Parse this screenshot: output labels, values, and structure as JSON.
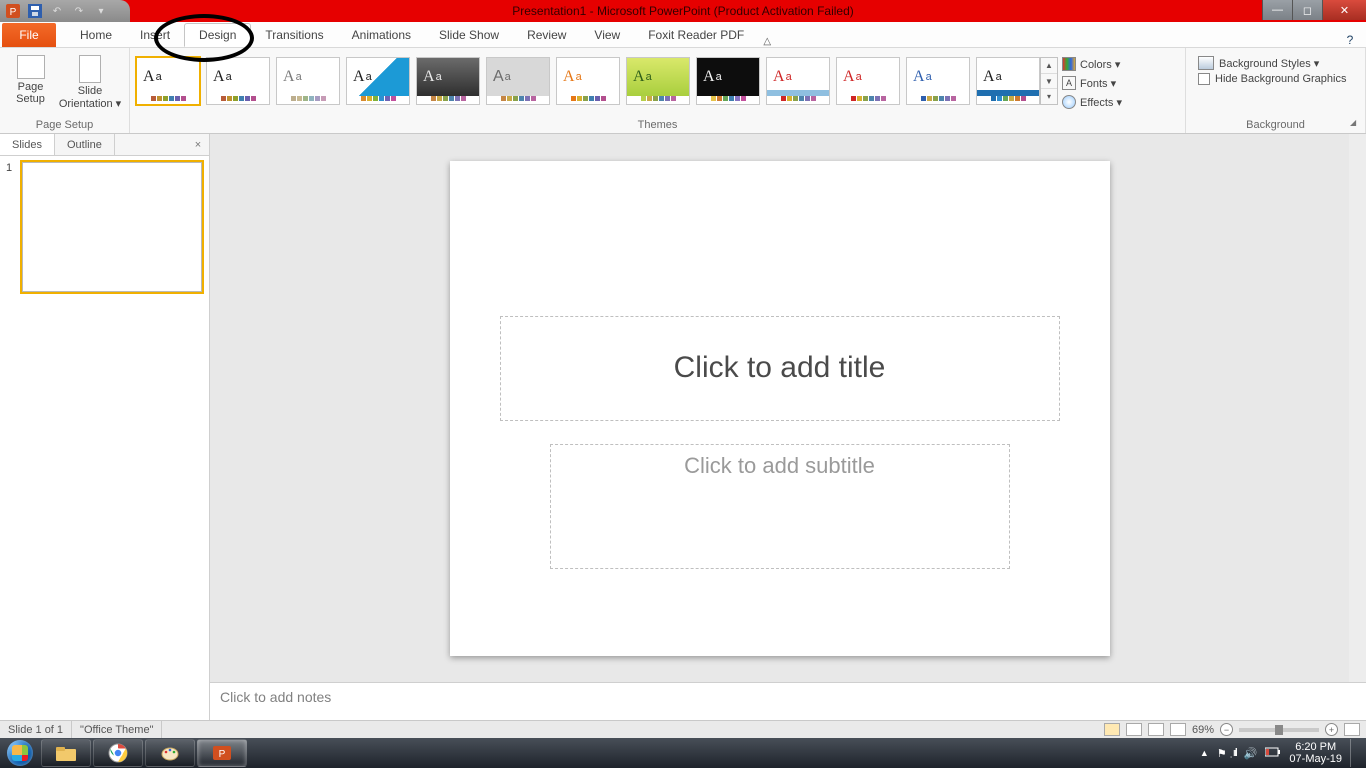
{
  "title": "Presentation1  -  Microsoft PowerPoint (Product Activation Failed)",
  "tabs": {
    "file": "File",
    "items": [
      "Home",
      "Insert",
      "Design",
      "Transitions",
      "Animations",
      "Slide Show",
      "Review",
      "View",
      "Foxit Reader PDF"
    ],
    "active_index": 2
  },
  "ribbon": {
    "page_setup": {
      "label": "Page Setup",
      "page_setup_btn": "Page\nSetup",
      "orientation_btn": "Slide\nOrientation ▾"
    },
    "themes": {
      "label": "Themes",
      "items": [
        {
          "fg": "#1f1f1f",
          "bg": "#ffffff",
          "sw": [
            "#b85c39",
            "#c0912d",
            "#8fa02b",
            "#3f7fb0",
            "#6a5fae",
            "#b34f8e"
          ],
          "selected": true
        },
        {
          "fg": "#1f1f1f",
          "bg": "#ffffff",
          "sw": [
            "#b85c39",
            "#c0912d",
            "#8fa02b",
            "#3f7fb0",
            "#6a5fae",
            "#b34f8e"
          ]
        },
        {
          "fg": "#7a7a7a",
          "bg": "#ffffff",
          "sw": [
            "#bcae8e",
            "#c7b890",
            "#9fb588",
            "#8fb3bf",
            "#a79cc2",
            "#c79bb6"
          ]
        },
        {
          "fg": "#1f1f1f",
          "bg": "linear-gradient(135deg,#ffffff 50%,#1c9ad6 50%)",
          "sw": [
            "#d88b2f",
            "#d9b12d",
            "#82b23a",
            "#2f8ecf",
            "#6e63b5",
            "#c24f9c"
          ]
        },
        {
          "fg": "#e9e9e9",
          "bg": "linear-gradient(#6b6b6b,#2f2f2f)",
          "sw": [
            "#c58645",
            "#c9a945",
            "#8aa24b",
            "#4d84ad",
            "#7d72b5",
            "#b864a0"
          ]
        },
        {
          "fg": "#6b6b6b",
          "bg": "#d8d8d8",
          "sw": [
            "#c58645",
            "#c9a945",
            "#8aa24b",
            "#4d84ad",
            "#7d72b5",
            "#b864a0"
          ],
          "font": "sans"
        },
        {
          "fg": "#e67817",
          "bg": "#ffffff",
          "sw": [
            "#e67817",
            "#d9b12d",
            "#8aa24b",
            "#3f7fb0",
            "#6a5fae",
            "#b34f8e"
          ]
        },
        {
          "fg": "#2f5f1a",
          "bg": "linear-gradient(#d9e86a,#a9cf3e)",
          "sw": [
            "#b6cf4b",
            "#c9a945",
            "#8aa24b",
            "#4d84ad",
            "#7d72b5",
            "#b864a0"
          ]
        },
        {
          "fg": "#f1f1f1",
          "bg": "#0d0d0d",
          "sw": [
            "#e6c34a",
            "#cf7a2f",
            "#65a557",
            "#3f7fb0",
            "#8672c2",
            "#c24f9c"
          ]
        },
        {
          "fg": "#cf2626",
          "bg": "#ffffff",
          "accent_strip": "#8fbfe0",
          "sw": [
            "#cf2626",
            "#d9b12d",
            "#8aa24b",
            "#4d84ad",
            "#7d72b5",
            "#b864a0"
          ]
        },
        {
          "fg": "#cf2626",
          "bg": "#ffffff",
          "sw": [
            "#cf2626",
            "#d9b12d",
            "#8aa24b",
            "#4d84ad",
            "#7d72b5",
            "#b864a0"
          ]
        },
        {
          "fg": "#2f5fae",
          "bg": "#ffffff",
          "sw": [
            "#2f5fae",
            "#c9a945",
            "#8aa24b",
            "#4d84ad",
            "#7d72b5",
            "#b864a0"
          ]
        },
        {
          "fg": "#1f1f1f",
          "bg": "#ffffff",
          "accent_strip": "#1f6fb0",
          "sw": [
            "#1f6fb0",
            "#2f8ecf",
            "#65a557",
            "#c9a945",
            "#cf7a2f",
            "#b34f8e"
          ]
        }
      ],
      "variants": {
        "colors": "Colors ▾",
        "fonts": "Fonts ▾",
        "effects": "Effects ▾"
      }
    },
    "background": {
      "label": "Background",
      "styles_btn": "Background Styles ▾",
      "hide_cb": "Hide Background Graphics"
    }
  },
  "panel": {
    "tabs": [
      "Slides",
      "Outline"
    ],
    "active": 0,
    "thumb_number": "1"
  },
  "slide": {
    "title_ph": "Click to add title",
    "subtitle_ph": "Click to add subtitle"
  },
  "notes_ph": "Click to add notes",
  "statusbar": {
    "slide_info": "Slide 1 of 1",
    "theme_name": "\"Office Theme\"",
    "zoom": "69%"
  },
  "taskbar": {
    "time": "6:20 PM",
    "date": "07-May-19"
  }
}
